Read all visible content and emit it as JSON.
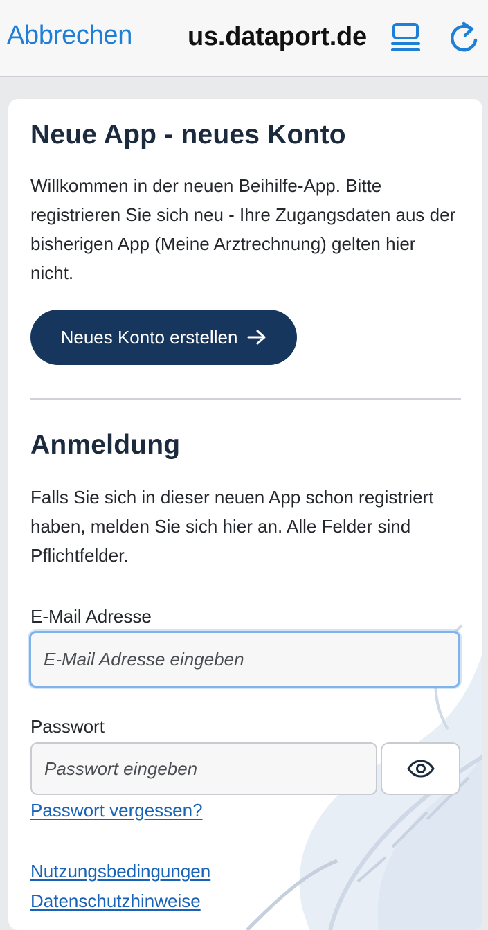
{
  "browser": {
    "cancel_label": "Abbrechen",
    "url": "us.dataport.de",
    "reader_icon": "reader-view-icon",
    "reload_icon": "reload-icon",
    "accent_color": "#1f7fd6"
  },
  "register": {
    "title": "Neue App - neues Konto",
    "text": "Willkommen in der neuen Beihilfe-App. Bitte registrieren Sie sich neu - Ihre Zugangsdaten aus der bisherigen App (Meine Arztrechnung) gelten hier nicht.",
    "button_label": "Neues Konto erstellen",
    "button_icon": "arrow-right-icon",
    "button_color": "#17365d"
  },
  "login": {
    "title": "Anmeldung",
    "text": "Falls Sie sich in dieser neuen App schon registriert haben, melden Sie sich hier an. Alle Felder sind Pflichtfelder.",
    "email_label": "E-Mail Adresse",
    "email_placeholder": "E-Mail Adresse eingeben",
    "email_value": "",
    "password_label": "Passwort",
    "password_placeholder": "Passwort eingeben",
    "password_value": "",
    "show_password_icon": "eye-icon",
    "forgot_password": "Passwort vergessen?"
  },
  "footer": {
    "terms": "Nutzungsbedingungen",
    "privacy": "Datenschutzhinweise"
  }
}
